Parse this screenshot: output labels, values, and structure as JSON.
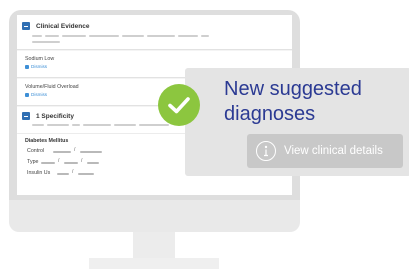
{
  "clinical_evidence": {
    "title": "Clinical Evidence",
    "items": [
      {
        "label": "Sodium Low",
        "action": "Dismiss"
      },
      {
        "label": "Volume/Fluid Overload",
        "action": "Dismiss"
      }
    ]
  },
  "specificity": {
    "title": "1 Specificity",
    "diagnosis": "Diabetes Mellitus",
    "fields": [
      "Control",
      "Type",
      "Insulin Us"
    ]
  },
  "overlay": {
    "title": "New suggested diagnoses",
    "button_label": "View clinical details"
  },
  "colors": {
    "accent_blue": "#2f6fb3",
    "success_green": "#8cc63f",
    "title_navy": "#2b3a93"
  }
}
